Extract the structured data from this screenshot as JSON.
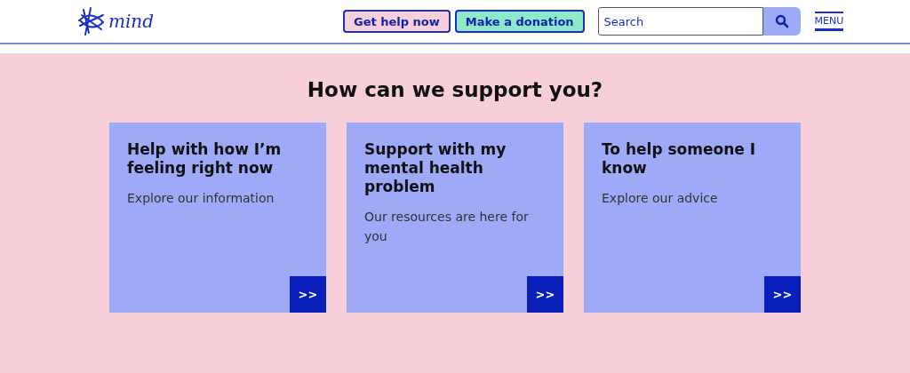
{
  "header": {
    "logo_text": "mind",
    "buttons": [
      {
        "label": "Get help now",
        "kind": "help"
      },
      {
        "label": "Make a donation",
        "kind": "donate"
      }
    ],
    "search": {
      "placeholder": "Search"
    },
    "menu": "MENU"
  },
  "main": {
    "heading": "How can we support you?",
    "cards": [
      {
        "title": "Help with how I’m feeling right now",
        "text": "Explore our information",
        "arrow": ">>"
      },
      {
        "title": "Support with my mental health problem",
        "text": "Our resources are here for you",
        "arrow": ">>"
      },
      {
        "title": "To help someone I know",
        "text": "Explore our advice",
        "arrow": ">>"
      }
    ]
  }
}
